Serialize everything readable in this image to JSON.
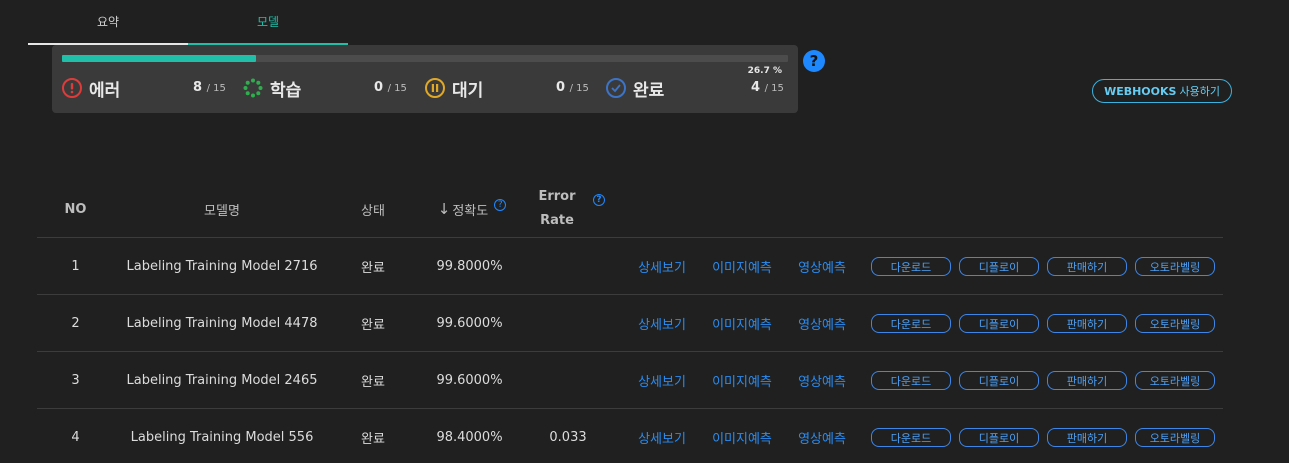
{
  "tabs": [
    {
      "label": "요약"
    },
    {
      "label": "모델"
    }
  ],
  "status_panel": {
    "progress": 0.267,
    "percent_text": "26.7 %",
    "stats": [
      {
        "label": "에러",
        "count": "8",
        "total": "/ 15",
        "icon": "error-icon",
        "color": "#e03b3b"
      },
      {
        "label": "학습",
        "count": "0",
        "total": "/ 15",
        "icon": "training-spinner-icon",
        "color": "#2fae4e"
      },
      {
        "label": "대기",
        "count": "0",
        "total": "/ 15",
        "icon": "pause-icon",
        "color": "#e0a825"
      },
      {
        "label": "완료",
        "count": "4",
        "total": "/ 15",
        "icon": "check-icon",
        "color": "#3c74c8"
      }
    ]
  },
  "help_icon": "?",
  "webhooks": {
    "label_en": "WEBHOOKS",
    "label_ko": "사용하기"
  },
  "table": {
    "headers": {
      "no": "NO",
      "name": "모델명",
      "status": "상태",
      "accuracy": "정확도",
      "error_rate_1": "Error",
      "error_rate_2": "Rate",
      "help": "?"
    },
    "rows": [
      {
        "no": "1",
        "name": "Labeling Training Model 2716",
        "status": "완료",
        "accuracy": "99.8000%",
        "error_rate": ""
      },
      {
        "no": "2",
        "name": "Labeling Training Model 4478",
        "status": "완료",
        "accuracy": "99.6000%",
        "error_rate": ""
      },
      {
        "no": "3",
        "name": "Labeling Training Model 2465",
        "status": "완료",
        "accuracy": "99.6000%",
        "error_rate": ""
      },
      {
        "no": "4",
        "name": "Labeling Training Model 556",
        "status": "완료",
        "accuracy": "98.4000%",
        "error_rate": "0.033"
      }
    ],
    "actions": {
      "detail": "상세보기",
      "image_predict": "이미지예측",
      "video_predict": "영상예측",
      "download": "다운로드",
      "deploy": "디플로이",
      "sell": "판매하기",
      "autolabel": "오토라벨링"
    }
  },
  "colors": {
    "accent": "#1fbfa9",
    "link": "#2b8cf0",
    "background": "#202020"
  }
}
